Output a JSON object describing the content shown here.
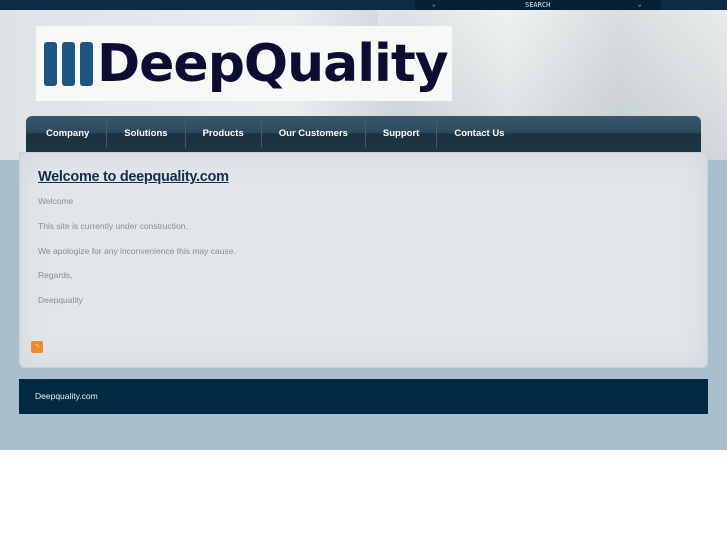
{
  "topbar": {
    "search_label": "SEARCH",
    "chevron_left": "⌄",
    "chevron_right": "⌄"
  },
  "logo": {
    "text": "DeepQuality"
  },
  "nav": [
    "Company",
    "Solutions",
    "Products",
    "Our Customers",
    "Support",
    "Contact Us"
  ],
  "content": {
    "title": "Welcome to deepquality.com",
    "paragraphs": [
      "Welcome",
      "This site is currently under construction.",
      "We apologize for any inconvenience this may cause.",
      "Regards,",
      "Deepquality"
    ],
    "rss_icon": "rss-feed-icon"
  },
  "footer": {
    "text": "Deepquality.com"
  },
  "colors": {
    "nav": "#2c4b5e",
    "footer": "#022a42",
    "title": "#10304f",
    "background": "#aabfcd"
  }
}
